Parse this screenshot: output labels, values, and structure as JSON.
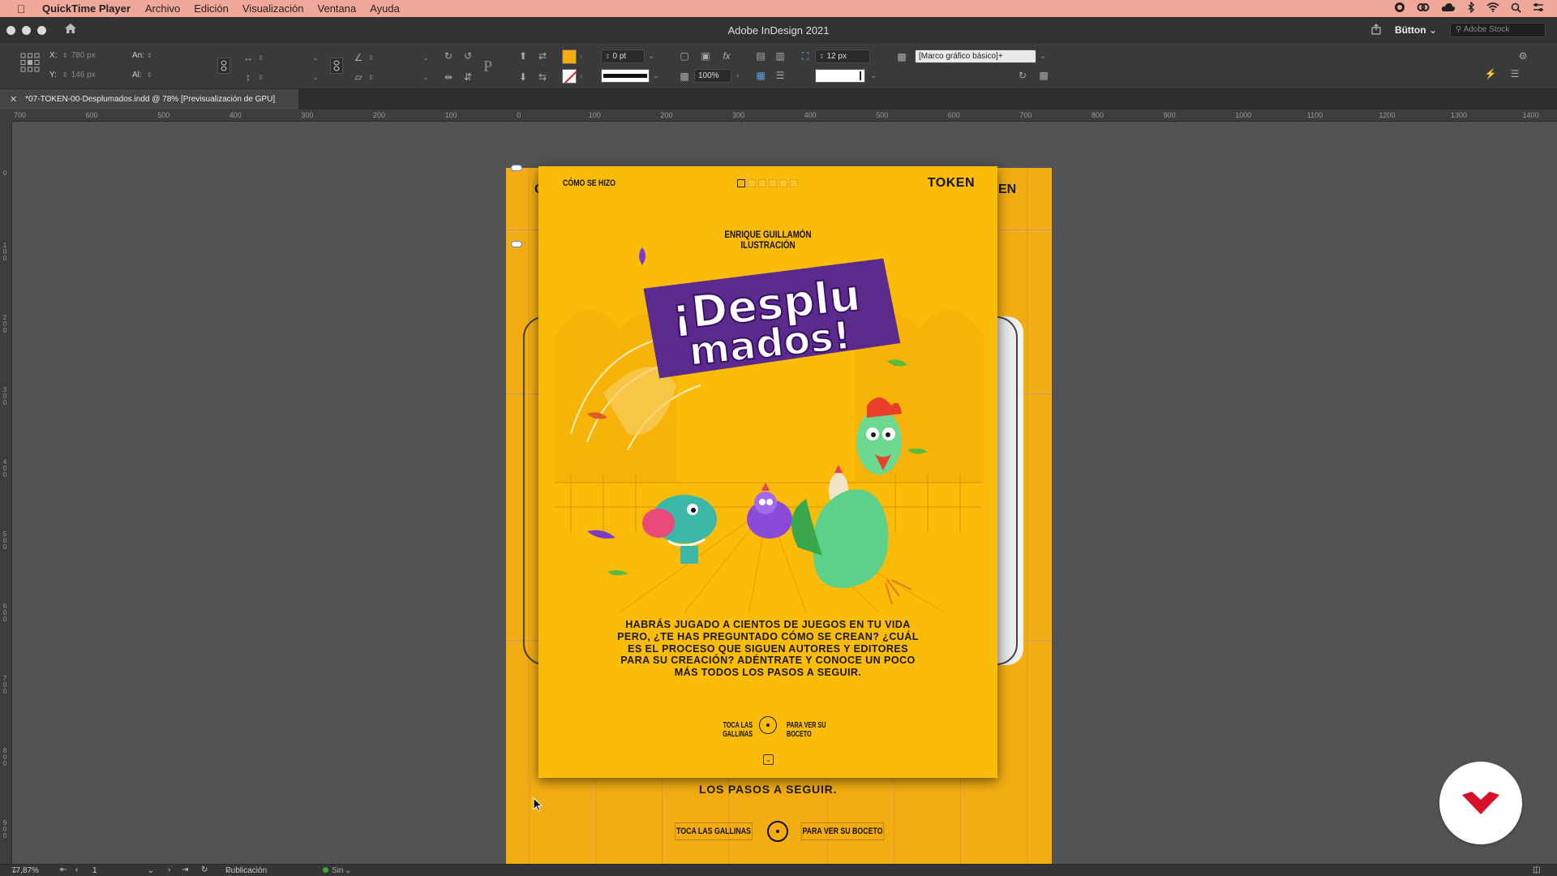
{
  "menubar": {
    "app_name": "QuickTime Player",
    "items": [
      "Archivo",
      "Edición",
      "Visualización",
      "Ventana",
      "Ayuda"
    ],
    "status_icons": [
      "record-icon",
      "creative-cloud-icon",
      "cloud-icon",
      "bluetooth-icon",
      "wifi-icon",
      "spotlight-search-icon",
      "control-center-icon"
    ]
  },
  "titlebar": {
    "window_title": "Adobe InDesign 2021",
    "workspace": "Bütton",
    "stock_search_placeholder": "Adobe Stock"
  },
  "control_panel": {
    "x_label": "X:",
    "x_value": "780 px",
    "y_label": "Y:",
    "y_value": "146 px",
    "width_label": "An:",
    "height_label": "Al:",
    "stroke_weight": "0 pt",
    "opacity": "100%",
    "corner_size": "12 px",
    "object_style": "[Marco gráfico básico]+",
    "fill_color": "#f7ad10"
  },
  "document_tab": {
    "title": "*07-TOKEN-00-Desplumados.indd @ 78% [Previsualización de GPU]"
  },
  "ruler_top_labels": [
    "700",
    "600",
    "500",
    "400",
    "300",
    "200",
    "100",
    "0",
    "100",
    "200",
    "300",
    "400",
    "500",
    "600",
    "700",
    "800",
    "900",
    "1000",
    "1100",
    "1200",
    "1300",
    "1400"
  ],
  "ruler_left_labels": [
    "0",
    "100",
    "200",
    "300",
    "400",
    "500",
    "600",
    "700",
    "800",
    "900"
  ],
  "front_page": {
    "top_left": "CÓMO SE HIZO",
    "top_right": "TOKEN",
    "author_name": "ENRIQUE GUILLAMÓN",
    "author_role": "ILUSTRACIÓN",
    "title_line1": "¡Desplu",
    "title_line2": "mados!",
    "intro": "HABRÁS JUGADO A CIENTOS DE JUEGOS EN TU VIDA PERO, ¿TE HAS PREGUNTADO CÓMO SE CREAN? ¿CUÁL ES EL PROCESO QUE SIGUEN AUTORES Y EDITORES PARA SU CREACIÓN? ADÉNTRATE Y CONOCE UN POCO MÁS TODOS LOS PASOS A SEGUIR.",
    "cta_left": "TOCA LAS GALLINAS",
    "cta_right": "PARA VER SU BOCETO",
    "page_color": "#fbbb09"
  },
  "back_page": {
    "edge_text_left": "C",
    "edge_text_right": "EN",
    "bottom_text": "LOS PASOS A SEGUIR.",
    "btn_left": "TOCA LAS GALLINAS",
    "btn_right": "PARA VER SU BOCETO"
  },
  "statusbar": {
    "zoom": "77,87%",
    "page_number": "1",
    "preflight_profile": "Publicación digital",
    "errors": "Sin errores"
  }
}
